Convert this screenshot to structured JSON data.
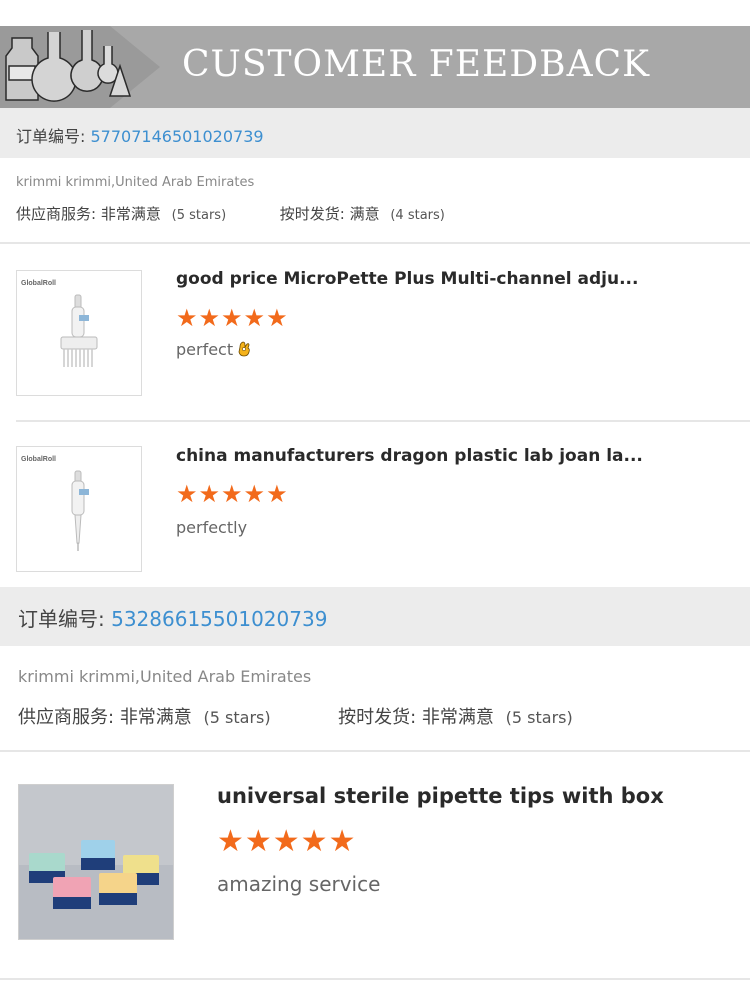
{
  "banner": {
    "title": "CUSTOMER FEEDBACK",
    "icon": "lab-glassware-icon"
  },
  "orders": [
    {
      "order_label": "订单编号:",
      "order_number": "57707146501020739",
      "buyer": "krimmi krimmi,United Arab Emirates",
      "supplier_service_label": "供应商服务:",
      "supplier_service_value": "非常满意",
      "supplier_service_stars": "(5 stars)",
      "delivery_label": "按时发货:",
      "delivery_value": "满意",
      "delivery_stars": "(4 stars)",
      "products": [
        {
          "brand": "GlobalRoll",
          "title": "good price MicroPette Plus Multi-channel adju...",
          "rating": 5,
          "stars": "★★★★★",
          "comment": "perfect",
          "emoji": "ok-hand-icon"
        },
        {
          "brand": "GlobalRoll",
          "title": "china manufacturers dragon plastic lab joan la...",
          "rating": 5,
          "stars": "★★★★★",
          "comment": "perfectly"
        }
      ]
    },
    {
      "order_label": "订单编号:",
      "order_number": "53286615501020739",
      "buyer": "krimmi krimmi,United Arab Emirates",
      "supplier_service_label": "供应商服务:",
      "supplier_service_value": "非常满意",
      "supplier_service_stars": "(5 stars)",
      "delivery_label": "按时发货:",
      "delivery_value": "非常满意",
      "delivery_stars": "(5 stars)",
      "products": [
        {
          "title": "universal sterile pipette tips with box",
          "rating": 5,
          "stars": "★★★★★",
          "comment": "amazing service"
        }
      ]
    }
  ],
  "colors": {
    "accent_star": "#f26a1b",
    "order_number": "#3d8fd0",
    "banner": "#a8a8a8"
  }
}
